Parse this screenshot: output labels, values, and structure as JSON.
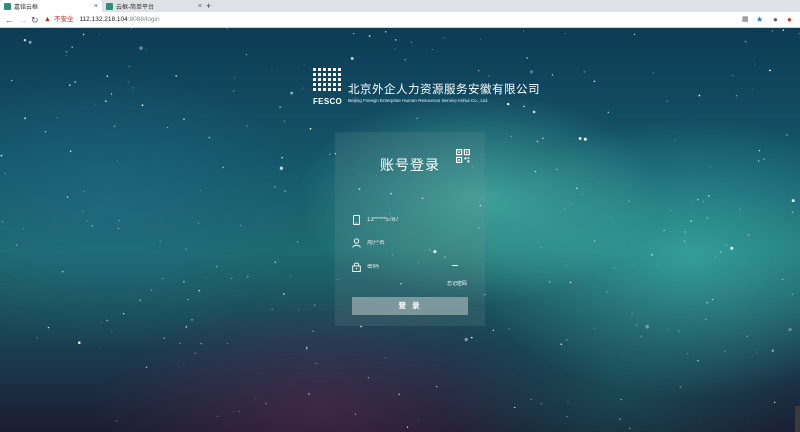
{
  "browser": {
    "tabs": [
      {
        "title": "嘉铭云框",
        "active": true
      },
      {
        "title": "云框-简单平台",
        "active": false
      }
    ],
    "tab_close": "×",
    "new_tab": "+",
    "address": {
      "security_label": "不安全",
      "host": "112.132.218.104",
      "path": ":8088/login"
    }
  },
  "brand": {
    "logo_word": "FESCO",
    "name_cn": "北京外企人力资源服务安徽有限公司",
    "name_en": "Beijing Foreign Enterprise Human Resources Service Anhui Co., Ltd."
  },
  "login": {
    "title": "账号登录",
    "phone_value": "13*****5787",
    "username_placeholder": "用户名",
    "password_placeholder": "密码",
    "forgot_label": "忘记密码",
    "submit_label": "登 录"
  },
  "colors": {
    "accent": "#2d8f7b",
    "warning": "#c5221f",
    "chrome_bg": "#dee1e6"
  },
  "icons": {
    "qr": "qr-code-icon",
    "phone": "phone-icon",
    "user": "user-icon",
    "lock": "lock-icon"
  }
}
